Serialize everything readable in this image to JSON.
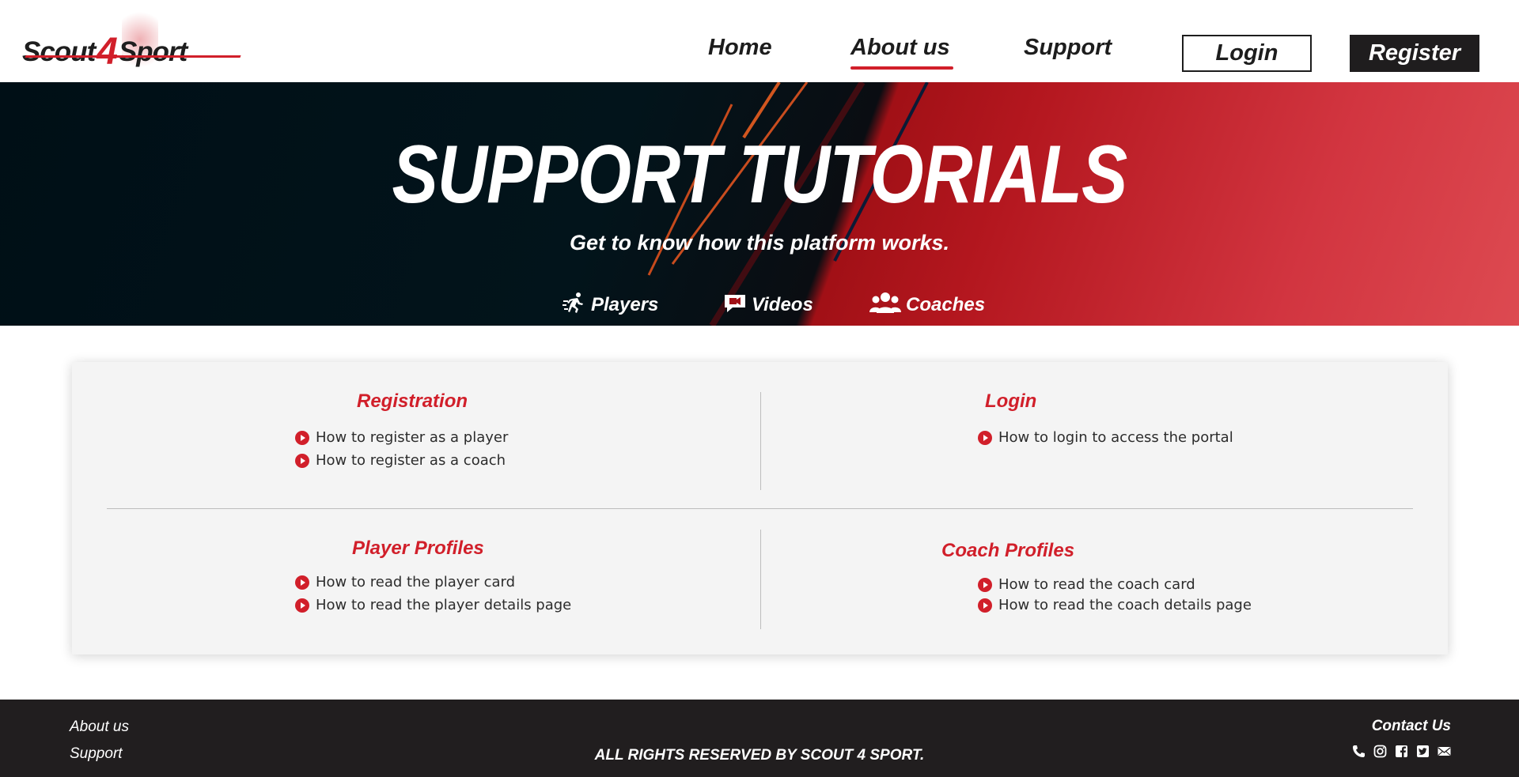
{
  "brand": {
    "logo_left": "Scout",
    "logo_four": "4",
    "logo_right": "Sport",
    "accent_color": "#d11f2a",
    "dark_color": "#1f1d1e"
  },
  "nav": {
    "home": "Home",
    "about": "About us",
    "support": "Support",
    "active": "About us"
  },
  "auth": {
    "login": "Login",
    "register": "Register"
  },
  "hero": {
    "title": "Support Tutorials",
    "subtitle": "Get to know how this platform works.",
    "links": [
      {
        "label": "Players",
        "icon": "running-player-icon"
      },
      {
        "label": "Videos",
        "icon": "video-chat-icon"
      },
      {
        "label": "Coaches",
        "icon": "users-group-icon"
      }
    ]
  },
  "sections": {
    "registration": {
      "title": "Registration",
      "items": [
        "How to register as a player",
        "How to register as a coach"
      ]
    },
    "login": {
      "title": "Login",
      "items": [
        "How to login to access the portal"
      ]
    },
    "player_profiles": {
      "title": "Player Profiles",
      "items": [
        "How to read the player card",
        "How to read the player details page"
      ]
    },
    "coach_profiles": {
      "title": "Coach Profiles",
      "items": [
        "How to read the coach card",
        "How to read the coach details page"
      ]
    }
  },
  "footer": {
    "about": "About us",
    "support": "Support",
    "rights": "ALL RIGHTS RESERVED BY SCOUT 4 SPORT.",
    "contact": "Contact Us",
    "icons": [
      "phone-icon",
      "instagram-icon",
      "facebook-icon",
      "twitter-icon",
      "mail-icon"
    ]
  }
}
